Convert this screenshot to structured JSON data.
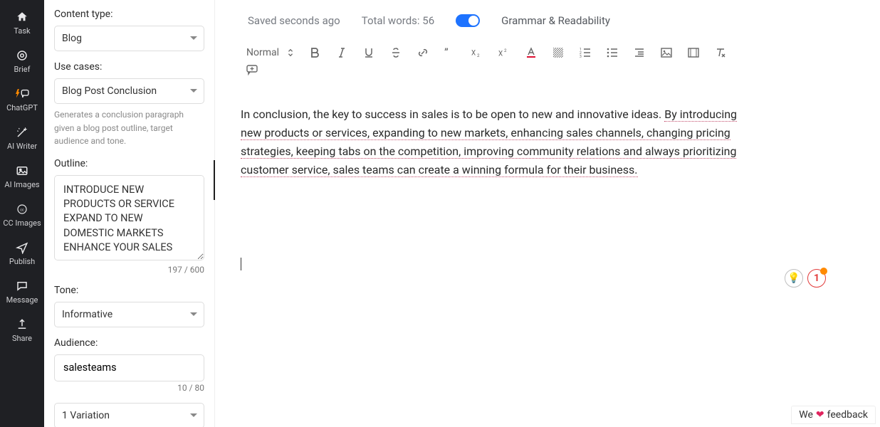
{
  "rail": {
    "items": [
      {
        "label": "Task"
      },
      {
        "label": "Brief"
      },
      {
        "label": "ChatGPT"
      },
      {
        "label": "AI Writer"
      },
      {
        "label": "AI Images"
      },
      {
        "label": "CC Images"
      },
      {
        "label": "Publish"
      },
      {
        "label": "Message"
      },
      {
        "label": "Share"
      }
    ]
  },
  "panel": {
    "content_type_label": "Content type:",
    "content_type_value": "Blog",
    "use_cases_label": "Use cases:",
    "use_cases_value": "Blog Post Conclusion",
    "use_cases_hint": "Generates a conclusion paragraph given a blog post outline, target audience and tone.",
    "outline_label": "Outline:",
    "outline_value": "INTRODUCE NEW PRODUCTS OR SERVICE\nEXPAND TO NEW DOMESTIC MARKETS\nENHANCE YOUR SALES",
    "outline_counter": "197 / 600",
    "tone_label": "Tone:",
    "tone_value": "Informative",
    "audience_label": "Audience:",
    "audience_value": "salesteams",
    "audience_counter": "10 / 80",
    "variations_value": "1 Variation"
  },
  "status": {
    "saved": "Saved seconds ago",
    "words": "Total words: 56",
    "toggle_label": "Grammar & Readability"
  },
  "toolbar": {
    "style_label": "Normal"
  },
  "content": {
    "plain": "In conclusion, the key to success in sales is to be open to new and innovative ideas. ",
    "underlined": "By introducing new products or services, expanding to new markets, enhancing sales channels, changing pricing strategies, keeping tabs on the competition, improving community relations and always prioritizing customer service, sales teams can create a winning formula for their business."
  },
  "pins": {
    "bulb": "💡",
    "count": "1"
  },
  "feedback": {
    "pre": "We ",
    "heart": "❤",
    "post": " feedback"
  }
}
